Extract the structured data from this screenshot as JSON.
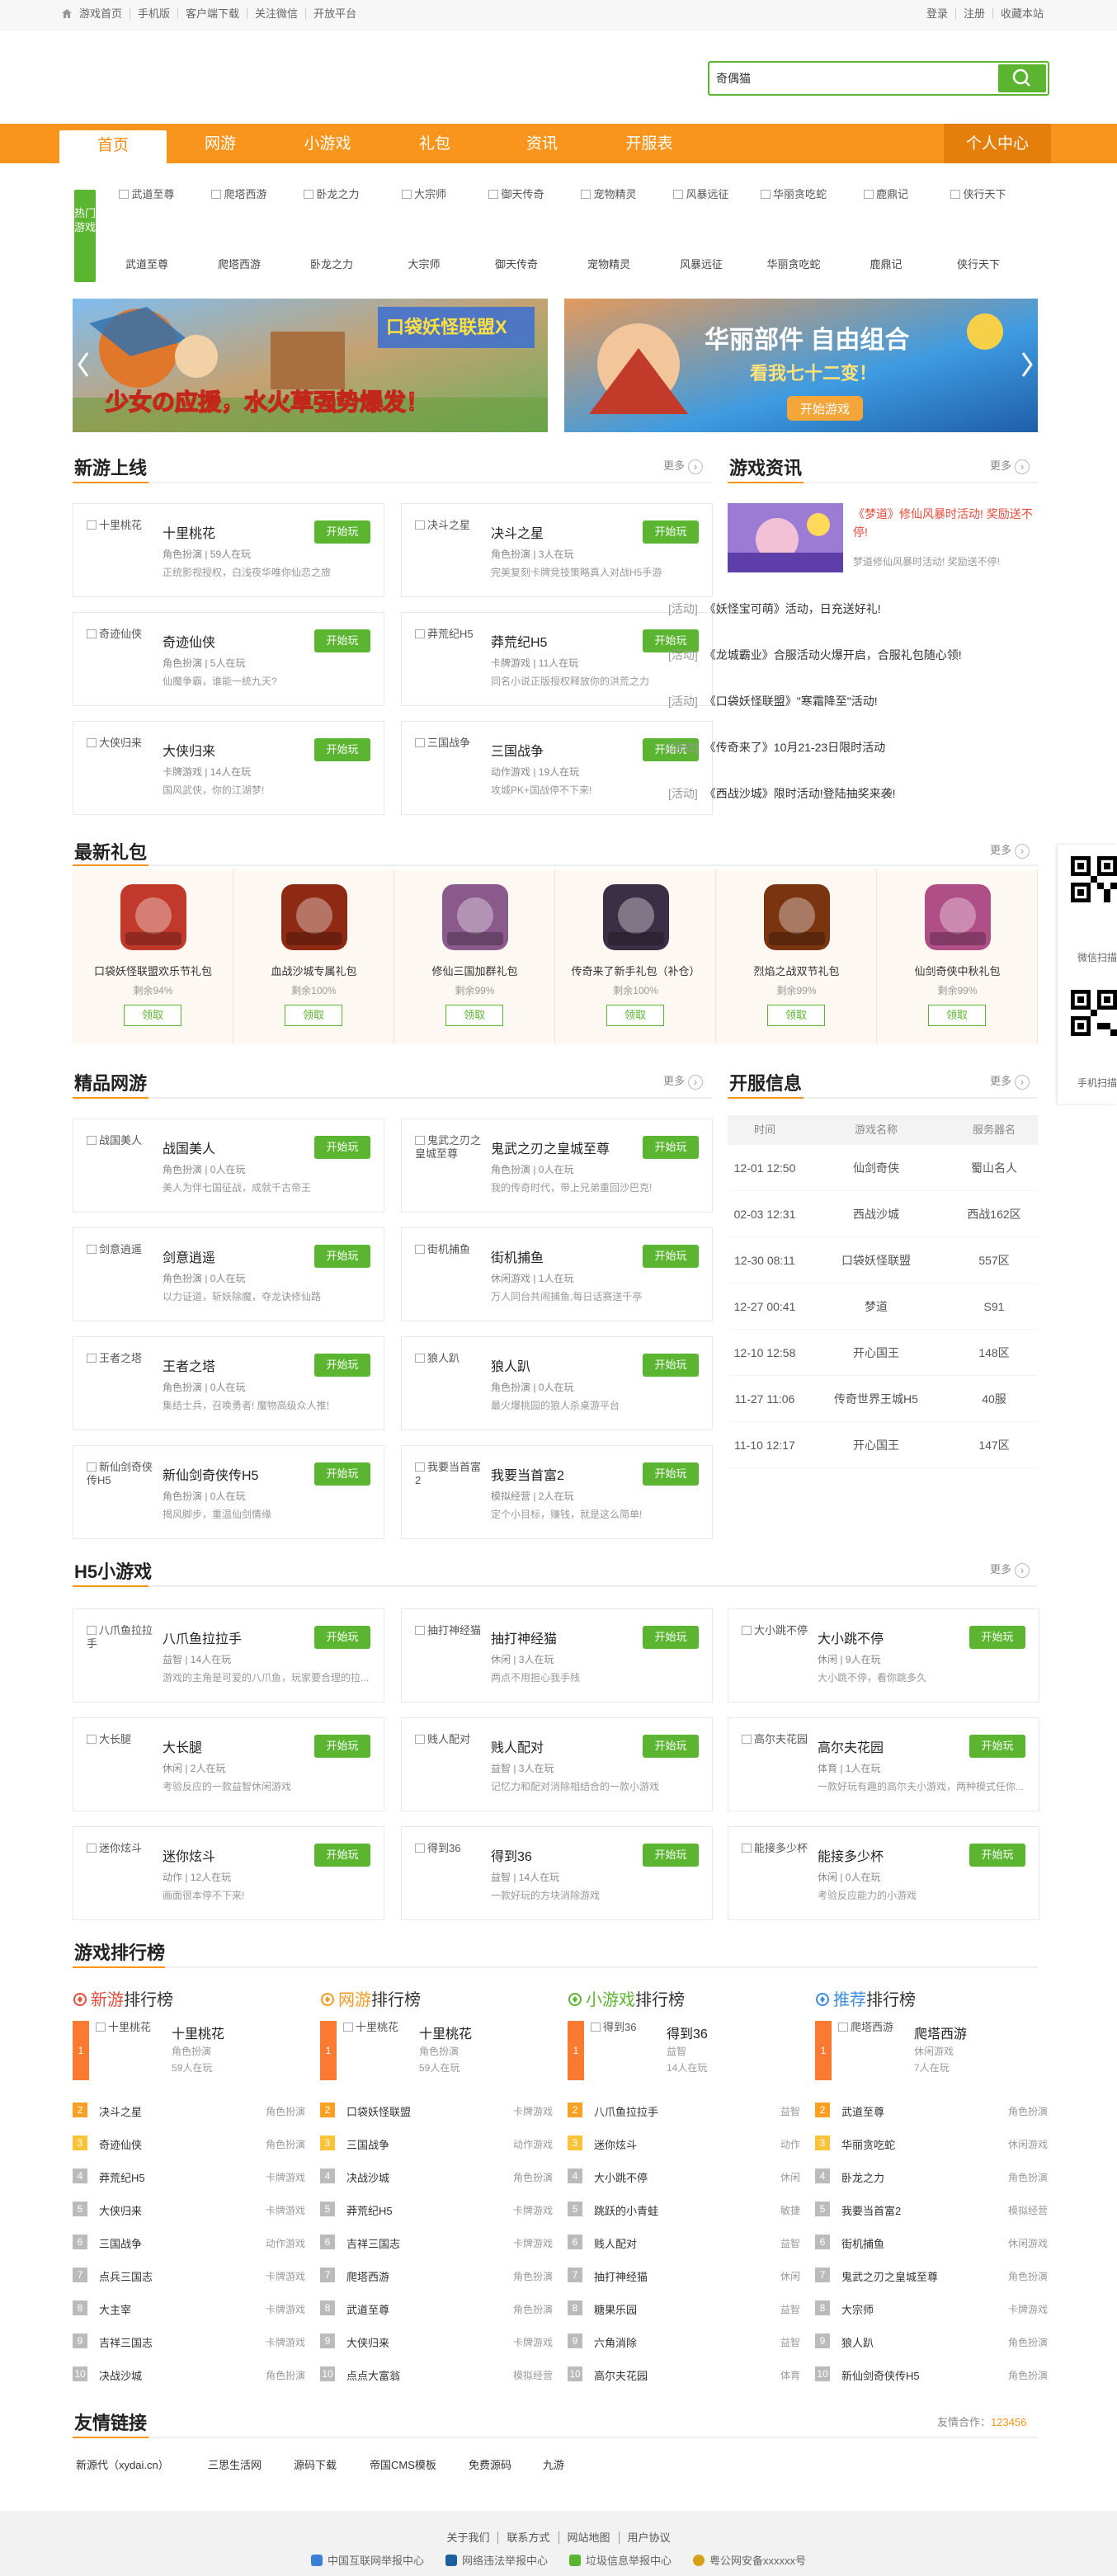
{
  "topbar": {
    "left": [
      "游戏首页",
      "手机版",
      "客户端下载",
      "关注微信",
      "开放平台"
    ],
    "right": [
      "登录",
      "注册",
      "收藏本站"
    ]
  },
  "search": {
    "value": "奇偶猫"
  },
  "nav": {
    "items": [
      "首页",
      "网游",
      "小游戏",
      "礼包",
      "资讯",
      "开服表"
    ],
    "personal": "个人中心"
  },
  "hot": {
    "tag": "热门游戏",
    "games": [
      {
        "alt": "武道至尊",
        "name": "武道至尊"
      },
      {
        "alt": "爬塔西游",
        "name": "爬塔西游"
      },
      {
        "alt": "卧龙之力",
        "name": "卧龙之力"
      },
      {
        "alt": "大宗师",
        "name": "大宗师"
      },
      {
        "alt": "御天传奇",
        "name": "御天传奇"
      },
      {
        "alt": "宠物精灵",
        "name": "宠物精灵"
      },
      {
        "alt": "风暴远征",
        "name": "风暴远征"
      },
      {
        "alt": "华丽贪吃蛇",
        "name": "华丽贪吃蛇"
      },
      {
        "alt": "鹿鼎记",
        "name": "鹿鼎记"
      },
      {
        "alt": "侠行天下",
        "name": "侠行天下"
      }
    ]
  },
  "banners": [
    {
      "title": "少女の应援，水火草强势爆发！",
      "badge": "口袋妖怪联盟X"
    },
    {
      "title": "华丽部件 自由组合",
      "subtitle": "看我七十二变！",
      "button": "开始游戏"
    }
  ],
  "new_games": {
    "title": "新游上线",
    "more": "更多",
    "items": [
      {
        "name": "十里桃花",
        "meta": "角色扮演 | 59人在玩",
        "desc": "正统影视授权，白浅夜华唯你仙恋之旅",
        "btn": "开始玩"
      },
      {
        "name": "决斗之星",
        "meta": "角色扮演 | 3人在玩",
        "desc": "完美复刻卡牌竞技策略真人对战H5手游",
        "btn": "开始玩"
      },
      {
        "name": "奇迹仙侠",
        "meta": "角色扮演 | 5人在玩",
        "desc": "仙魔争霸，谁能一统九天?",
        "btn": "开始玩"
      },
      {
        "name": "莽荒纪H5",
        "meta": "卡牌游戏 | 11人在玩",
        "desc": "同名小说正版授权释放你的洪荒之力",
        "btn": "开始玩"
      },
      {
        "name": "大侠归来",
        "meta": "卡牌游戏 | 14人在玩",
        "desc": "国风武侠，你的江湖梦!",
        "btn": "开始玩"
      },
      {
        "name": "三国战争",
        "meta": "动作游戏 | 19人在玩",
        "desc": "攻城PK+国战停不下来!",
        "btn": "开始玩"
      }
    ],
    "pics": [
      "十里桃花",
      "决斗之星",
      "奇迹仙侠",
      "莽荒纪H5",
      "大侠归来",
      "三国战争"
    ]
  },
  "news": {
    "title": "游戏资讯",
    "more": "更多",
    "featured": {
      "title": "《梦道》修仙风暴时活动! 奖励送不停!",
      "sub": "梦道修仙风暴时活动! 奖励送不停!"
    },
    "items": [
      {
        "cat": "[活动]",
        "title": "《妖怪宝可萌》活动，日充送好礼!"
      },
      {
        "cat": "[活动]",
        "title": "《龙城霸业》合服活动火爆开启，合服礼包随心领!"
      },
      {
        "cat": "[活动]",
        "title": "《口袋妖怪联盟》\"寒霜降至\"活动!"
      },
      {
        "cat": "[活动]",
        "title": "《传奇来了》10月21-23日限时活动"
      },
      {
        "cat": "[活动]",
        "title": "《西战沙城》限时活动!登陆抽奖来袭!"
      }
    ]
  },
  "gifts": {
    "title": "最新礼包",
    "more": "更多",
    "items": [
      {
        "name": "口袋妖怪联盟欢乐节礼包",
        "rate": "剩余94%",
        "btn": "领取"
      },
      {
        "name": "血战沙城专属礼包",
        "rate": "剩余100%",
        "btn": "领取"
      },
      {
        "name": "修仙三国加群礼包",
        "rate": "剩余99%",
        "btn": "领取"
      },
      {
        "name": "传奇来了新手礼包（补仓）",
        "rate": "剩余100%",
        "btn": "领取"
      },
      {
        "name": "烈焰之战双节礼包",
        "rate": "剩余99%",
        "btn": "领取"
      },
      {
        "name": "仙剑奇侠中秋礼包",
        "rate": "剩余99%",
        "btn": "领取"
      }
    ],
    "icon_colors": [
      "#c0392b",
      "#8e2a14",
      "#8a5a8c",
      "#3b2f45",
      "#7a3410",
      "#b04e88"
    ]
  },
  "online": {
    "title": "精品网游",
    "more": "更多",
    "items": [
      {
        "pic": "战国美人",
        "name": "战国美人",
        "meta": "角色扮演 | 0人在玩",
        "desc": "美人为伴七国征战，成就千古帝王",
        "btn": "开始玩"
      },
      {
        "pic": "鬼武之刃之皇城至尊",
        "name": "鬼武之刃之皇城至尊",
        "meta": "角色扮演 | 0人在玩",
        "desc": "我的传奇时代，带上兄弟重回沙巴克!",
        "btn": "开始玩"
      },
      {
        "pic": "剑意逍遥",
        "name": "剑意逍遥",
        "meta": "角色扮演 | 0人在玩",
        "desc": "以力证道，斩妖除魔，夺龙诀修仙路",
        "btn": "开始玩"
      },
      {
        "pic": "街机捕鱼",
        "name": "街机捕鱼",
        "meta": "休闲游戏 | 1人在玩",
        "desc": "万人同台共闹捕鱼,每日话赛送千亭",
        "btn": "开始玩"
      },
      {
        "pic": "王者之塔",
        "name": "王者之塔",
        "meta": "角色扮演 | 0人在玩",
        "desc": "集结士兵，召唤勇者! 魔物高级众人推!",
        "btn": "开始玩"
      },
      {
        "pic": "狼人趴",
        "name": "狼人趴",
        "meta": "角色扮演 | 0人在玩",
        "desc": "最火爆桃园的狼人杀桌游平台",
        "btn": "开始玩"
      },
      {
        "pic": "新仙剑奇侠传H5",
        "name": "新仙剑奇侠传H5",
        "meta": "角色扮演 | 0人在玩",
        "desc": "揭风脚步，重温仙剑情缘",
        "btn": "开始玩"
      },
      {
        "pic": "我要当首富2",
        "name": "我要当首富2",
        "meta": "模拟经营 | 2人在玩",
        "desc": "定个小目标，赚钱，就是这么简单!",
        "btn": "开始玩"
      }
    ]
  },
  "server": {
    "title": "开服信息",
    "more": "更多",
    "headers": [
      "时间",
      "游戏名称",
      "服务器名"
    ],
    "rows": [
      [
        "12-01 12:50",
        "仙剑奇侠",
        "蜀山名人"
      ],
      [
        "02-03 12:31",
        "西战沙城",
        "西战162区"
      ],
      [
        "12-30 08:11",
        "口袋妖怪联盟",
        "557区"
      ],
      [
        "12-27 00:41",
        "梦道",
        "S91"
      ],
      [
        "12-10 12:58",
        "开心国王",
        "148区"
      ],
      [
        "11-27 11:06",
        "传奇世界王城H5",
        "40服"
      ],
      [
        "11-10 12:17",
        "开心国王",
        "147区"
      ]
    ]
  },
  "h5": {
    "title": "H5小游戏",
    "more": "更多",
    "items": [
      {
        "pic": "八爪鱼拉拉手",
        "name": "八爪鱼拉拉手",
        "meta": "益智 | 14人在玩",
        "desc": "游戏的主角是可爱的八爪鱼，玩家要合理的拉...",
        "btn": "开始玩"
      },
      {
        "pic": "抽打神经猫",
        "name": "抽打神经猫",
        "meta": "休闲 | 3人在玩",
        "desc": "两点不用担心我手残",
        "btn": "开始玩"
      },
      {
        "pic": "大小跳不停",
        "name": "大小跳不停",
        "meta": "休闲 | 9人在玩",
        "desc": "大小跳不停，看你跳多久",
        "btn": "开始玩"
      },
      {
        "pic": "大长腿",
        "name": "大长腿",
        "meta": "休闲 | 2人在玩",
        "desc": "考验反应的一款益智休闲游戏",
        "btn": "开始玩"
      },
      {
        "pic": "贱人配对",
        "name": "贱人配对",
        "meta": "益智 | 3人在玩",
        "desc": "记忆力和配对消除相结合的一款小游戏",
        "btn": "开始玩"
      },
      {
        "pic": "高尔夫花园",
        "name": "高尔夫花园",
        "meta": "体育 | 1人在玩",
        "desc": "一款好玩有趣的高尔夫小游戏，两种模式任你...",
        "btn": "开始玩"
      },
      {
        "pic": "迷你炫斗",
        "name": "迷你炫斗",
        "meta": "动作 | 12人在玩",
        "desc": "画面很本停不下来!",
        "btn": "开始玩"
      },
      {
        "pic": "得到36",
        "name": "得到36",
        "meta": "益智 | 14人在玩",
        "desc": "一款好玩的方块消除游戏",
        "btn": "开始玩"
      },
      {
        "pic": "能接多少杯",
        "name": "能接多少杯",
        "meta": "休闲 | 0人在玩",
        "desc": "考验反应能力的小游戏",
        "btn": "开始玩"
      }
    ]
  },
  "rank": {
    "title": "游戏排行榜",
    "cols": [
      {
        "hl": "新游",
        "rest": "排行榜",
        "color": "#e84a3c",
        "top": {
          "pic": "十里桃花",
          "name": "十里桃花",
          "type": "角色扮演",
          "players": "59人在玩"
        },
        "rows": [
          [
            "决斗之星",
            "角色扮演"
          ],
          [
            "奇迹仙侠",
            "角色扮演"
          ],
          [
            "莽荒纪H5",
            "卡牌游戏"
          ],
          [
            "大侠归来",
            "卡牌游戏"
          ],
          [
            "三国战争",
            "动作游戏"
          ],
          [
            "点兵三国志",
            "卡牌游戏"
          ],
          [
            "大主宰",
            "卡牌游戏"
          ],
          [
            "吉祥三国志",
            "卡牌游戏"
          ],
          [
            "决战沙城",
            "角色扮演"
          ]
        ]
      },
      {
        "hl": "网游",
        "rest": "排行榜",
        "color": "#f39a1f",
        "top": {
          "pic": "十里桃花",
          "name": "十里桃花",
          "type": "角色扮演",
          "players": "59人在玩"
        },
        "rows": [
          [
            "口袋妖怪联盟",
            "卡牌游戏"
          ],
          [
            "三国战争",
            "动作游戏"
          ],
          [
            "决战沙城",
            "角色扮演"
          ],
          [
            "莽荒纪H5",
            "卡牌游戏"
          ],
          [
            "吉祥三国志",
            "卡牌游戏"
          ],
          [
            "爬塔西游",
            "角色扮演"
          ],
          [
            "武道至尊",
            "角色扮演"
          ],
          [
            "大侠归来",
            "卡牌游戏"
          ],
          [
            "点点大富翁",
            "模拟经营"
          ]
        ]
      },
      {
        "hl": "小游戏",
        "rest": "排行榜",
        "color": "#5bb531",
        "top": {
          "pic": "得到36",
          "name": "得到36",
          "type": "益智",
          "players": "14人在玩"
        },
        "rows": [
          [
            "八爪鱼拉拉手",
            "益智"
          ],
          [
            "迷你炫斗",
            "动作"
          ],
          [
            "大小跳不停",
            "休闲"
          ],
          [
            "跳跃的小青蛙",
            "敏捷"
          ],
          [
            "贱人配对",
            "益智"
          ],
          [
            "抽打神经猫",
            "休闲"
          ],
          [
            "糖果乐园",
            "益智"
          ],
          [
            "六角消除",
            "益智"
          ],
          [
            "高尔夫花园",
            "体育"
          ]
        ]
      },
      {
        "hl": "推荐",
        "rest": "排行榜",
        "color": "#3d8ee0",
        "top": {
          "pic": "爬塔西游",
          "name": "爬塔西游",
          "type": "休闲游戏",
          "players": "7人在玩"
        },
        "rows": [
          [
            "武道至尊",
            "角色扮演"
          ],
          [
            "华丽贪吃蛇",
            "休闲游戏"
          ],
          [
            "卧龙之力",
            "角色扮演"
          ],
          [
            "我要当首富2",
            "模拟经营"
          ],
          [
            "街机捕鱼",
            "休闲游戏"
          ],
          [
            "鬼武之刃之皇城至尊",
            "角色扮演"
          ],
          [
            "大宗师",
            "卡牌游戏"
          ],
          [
            "狼人趴",
            "角色扮演"
          ],
          [
            "新仙剑奇侠传H5",
            "角色扮演"
          ]
        ]
      }
    ]
  },
  "links": {
    "title": "友情链接",
    "coop_label": "友情合作：",
    "coop_value": "123456",
    "items": [
      "新源代（xydai.cn）",
      "三思生活网",
      "源码下载",
      "帝国CMS模板",
      "免费源码",
      "九游"
    ]
  },
  "footer": {
    "links": [
      "关于我们",
      "联系方式",
      "网站地图",
      "用户协议"
    ],
    "certs": [
      "中国互联网举报中心",
      "网络违法举报中心",
      "垃圾信息举报中心",
      "粤公网安备xxxxxx号"
    ]
  },
  "float": {
    "wechat": "微信扫描",
    "mobile": "手机扫描"
  },
  "colors": {
    "accent": "#f9951d",
    "green": "#5bb531"
  }
}
